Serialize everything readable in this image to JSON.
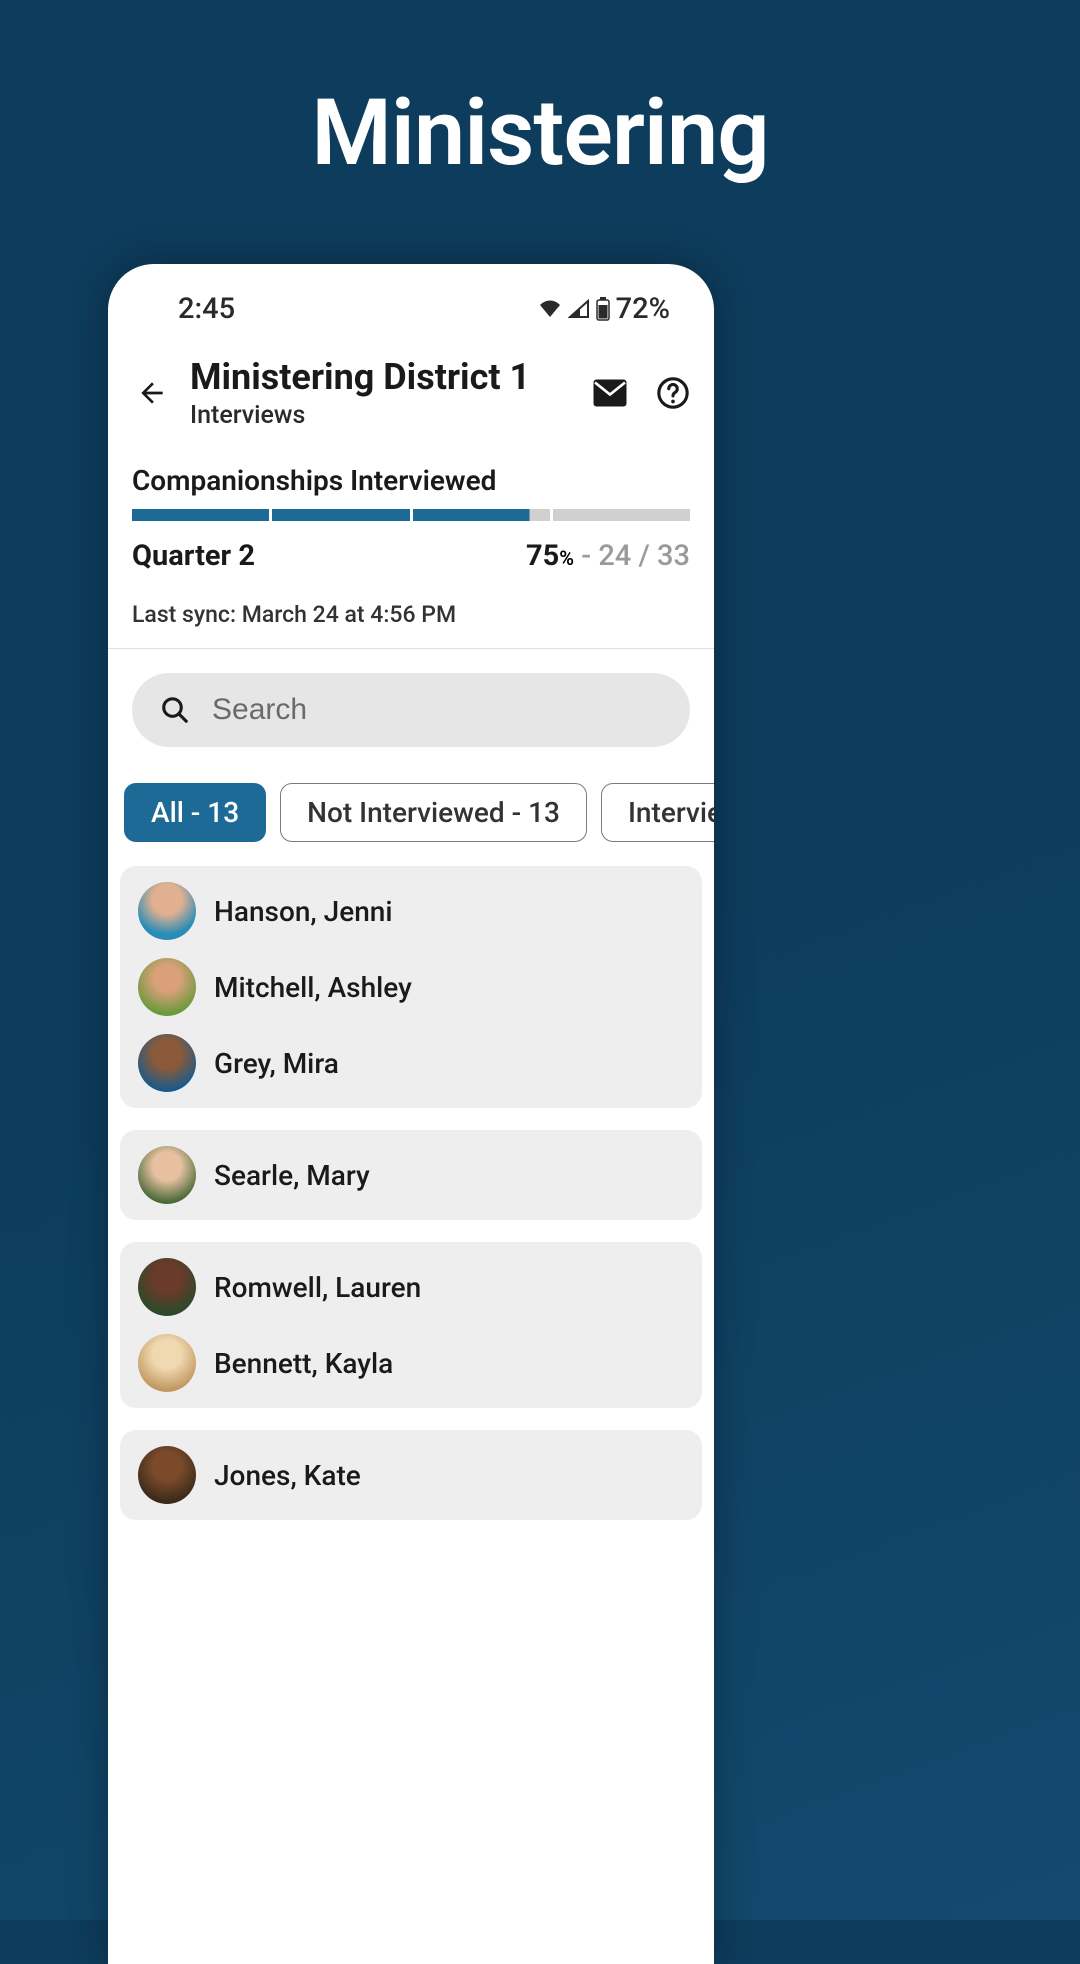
{
  "hero": {
    "title": "Ministering"
  },
  "statusbar": {
    "time": "2:45",
    "battery_pct": "72%"
  },
  "header": {
    "title": "Ministering District 1",
    "subtitle": "Interviews"
  },
  "progress": {
    "section_label": "Companionships Interviewed",
    "quarter": "Quarter 2",
    "percent": "75",
    "percent_unit": "%",
    "count_sep": " - ",
    "done": "24",
    "divider": " / ",
    "total": "33",
    "last_sync": "Last sync: March 24 at 4:56 PM"
  },
  "search": {
    "placeholder": "Search"
  },
  "filters": [
    {
      "label": "All - 13",
      "active": true
    },
    {
      "label": "Not Interviewed - 13",
      "active": false
    },
    {
      "label": "Interviewed",
      "active": false
    }
  ],
  "groups": [
    {
      "people": [
        {
          "name": "Hanson, Jenni",
          "avatar": "av1"
        },
        {
          "name": "Mitchell, Ashley",
          "avatar": "av2"
        },
        {
          "name": "Grey, Mira",
          "avatar": "av3"
        }
      ]
    },
    {
      "people": [
        {
          "name": "Searle, Mary",
          "avatar": "av4"
        }
      ]
    },
    {
      "people": [
        {
          "name": "Romwell, Lauren",
          "avatar": "av5"
        },
        {
          "name": "Bennett, Kayla",
          "avatar": "av6"
        }
      ]
    },
    {
      "people": [
        {
          "name": "Jones, Kate",
          "avatar": "av7"
        }
      ]
    }
  ]
}
